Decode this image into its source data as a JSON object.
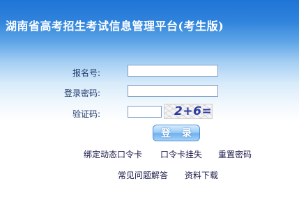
{
  "header": {
    "title": "湖南省高考招生考试信息管理平台(考生版)"
  },
  "form": {
    "username_label": "报名号:",
    "username_value": "",
    "password_label": "登录密码:",
    "password_value": "",
    "captcha_label": "验证码:",
    "captcha_value": "",
    "captcha_image_text": "2+6=?",
    "login_button": "登 录"
  },
  "links": {
    "bind_card": "绑定动态口令卡",
    "report_loss": "口令卡挂失",
    "reset_password": "重置密码",
    "faq": "常见问题解答",
    "downloads": "资料下载"
  },
  "colors": {
    "header_blue": "#1f74d6",
    "label_text": "#1f3a6b",
    "button_blue": "#6fb1ee"
  }
}
